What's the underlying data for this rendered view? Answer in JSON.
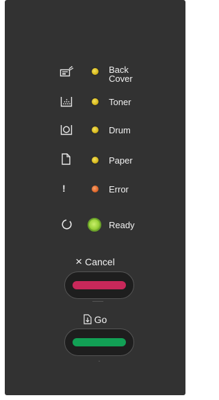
{
  "indicators": [
    {
      "label_line1": "Back",
      "label_line2": "Cover",
      "icon": "back-cover-icon",
      "led_color": "#d6b81c"
    },
    {
      "label": "Toner",
      "icon": "toner-icon",
      "led_color": "#d6b81c"
    },
    {
      "label": "Drum",
      "icon": "drum-icon",
      "led_color": "#d6b81c"
    },
    {
      "label": "Paper",
      "icon": "paper-icon",
      "led_color": "#d6b81c"
    },
    {
      "label": "Error",
      "icon": "exclamation-icon",
      "icon_glyph": "!",
      "led_color": "#e0672a"
    },
    {
      "label": "Ready",
      "icon": "power-icon",
      "led_color": "#9ad23a"
    }
  ],
  "buttons": {
    "cancel": {
      "label": "Cancel",
      "icon_glyph": "×",
      "icon": "x-icon",
      "bar_color": "#c8285a"
    },
    "go": {
      "label": "Go",
      "icon": "go-document-icon",
      "bar_color": "#12a055"
    }
  },
  "colors": {
    "panel_background": "#323232",
    "text": "#f2f2f2"
  }
}
